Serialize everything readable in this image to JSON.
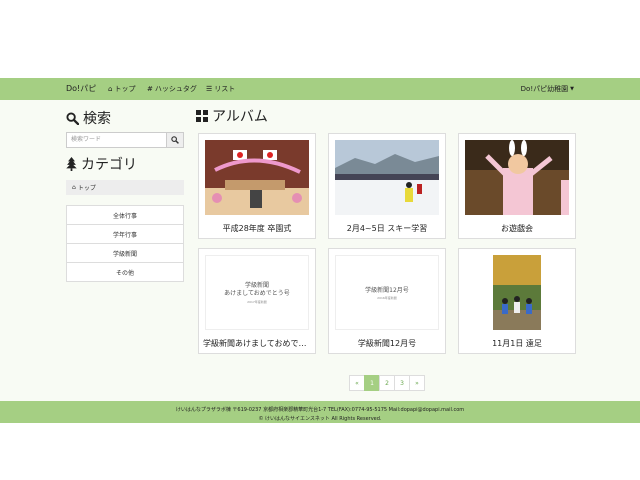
{
  "navbar": {
    "brand": "Do!パピ",
    "items": [
      {
        "label": "トップ",
        "icon": "home-icon"
      },
      {
        "label": "ハッシュタグ",
        "icon": "hash-icon"
      },
      {
        "label": "リスト",
        "icon": "list-icon"
      }
    ],
    "user_menu": "Do!パピ幼稚園",
    "bg_color": "#a5cf83"
  },
  "sidebar": {
    "search_heading": "検索",
    "search_placeholder": "検索ワード",
    "category_heading": "カテゴリ",
    "breadcrumb": "トップ",
    "categories": [
      "全体行事",
      "学年行事",
      "学級新聞",
      "その他"
    ]
  },
  "album": {
    "heading": "アルバム",
    "cards": [
      {
        "label": "平成28年度 卒園式"
      },
      {
        "label": "2月4~5日 スキー学習"
      },
      {
        "label": "お遊戯会"
      },
      {
        "label": "学級新聞あけましておめでとう号",
        "thumb_text": "学級新聞\nあけましておめでとう号",
        "thumb_sub": "2017年度新聞"
      },
      {
        "label": "学級新聞12月号",
        "thumb_text": "学級新聞12月号",
        "thumb_sub": "2016年度新聞"
      },
      {
        "label": "11月1日 遠足"
      }
    ]
  },
  "pagination": {
    "prev": "«",
    "pages": [
      "1",
      "2",
      "3"
    ],
    "active": "1",
    "next": "»"
  },
  "footer": {
    "line1": "けいはんなプラザラボ棟 〒619-0237 京都府相楽郡精華町光台1-7 TEL(FAX):0774-95-5175 Mail:dopapi@dopapi.mail.com",
    "line2": "© けいはんなサイエンスネット All Rights Reserved."
  }
}
